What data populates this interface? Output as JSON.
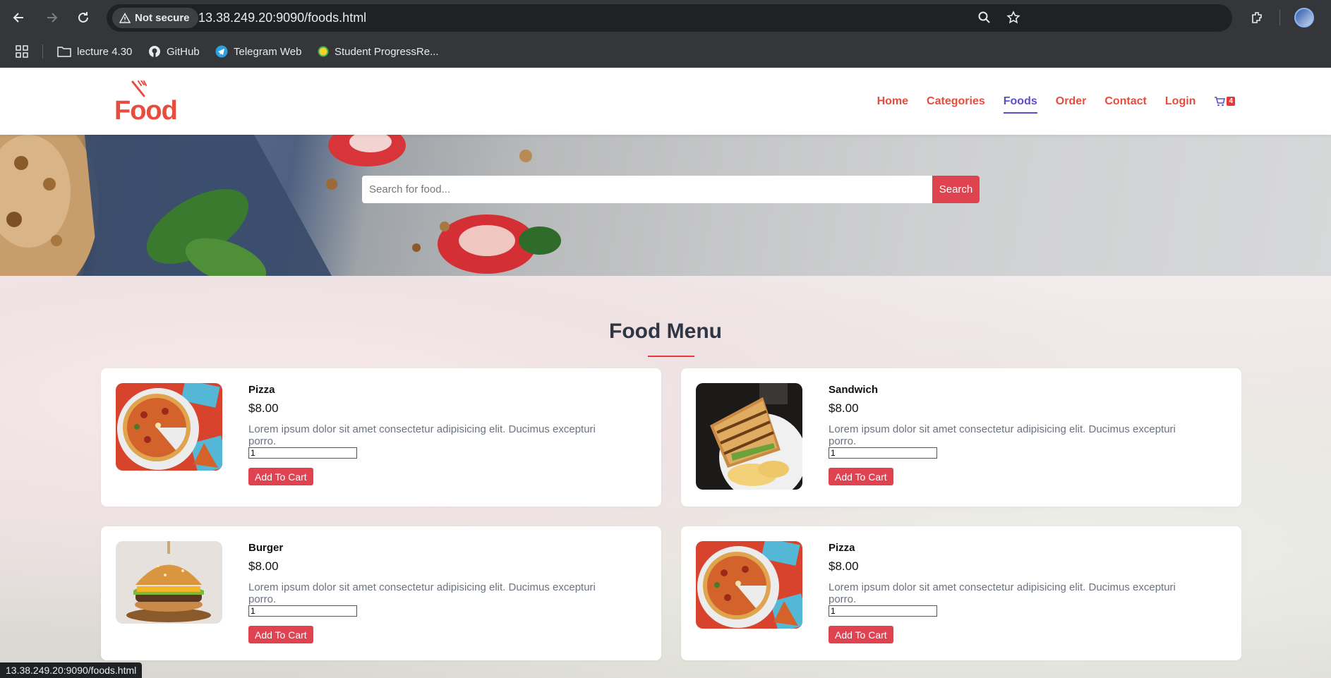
{
  "browser": {
    "security_label": "Not secure",
    "url": "13.38.249.20:9090/foods.html",
    "bookmarks": [
      {
        "label": "lecture 4.30",
        "icon": "folder-icon"
      },
      {
        "label": "GitHub",
        "icon": "github-icon"
      },
      {
        "label": "Telegram Web",
        "icon": "telegram-icon"
      },
      {
        "label": "Student ProgressRe...",
        "icon": "site-icon"
      }
    ],
    "status_url": "13.38.249.20:9090/foods.html"
  },
  "header": {
    "logo_text": "Food",
    "nav": [
      {
        "label": "Home",
        "active": false
      },
      {
        "label": "Categories",
        "active": false
      },
      {
        "label": "Foods",
        "active": true
      },
      {
        "label": "Order",
        "active": false
      },
      {
        "label": "Contact",
        "active": false
      },
      {
        "label": "Login",
        "active": false
      }
    ],
    "cart_count": "4"
  },
  "search": {
    "placeholder": "Search for food...",
    "button_label": "Search"
  },
  "menu": {
    "title": "Food Menu",
    "items": [
      {
        "name": "Pizza",
        "price": "$8.00",
        "description": "Lorem ipsum dolor sit amet consectetur adipisicing elit. Ducimus excepturi porro.",
        "quantity": "1",
        "button_label": "Add To Cart",
        "image": "pizza"
      },
      {
        "name": "Sandwich",
        "price": "$8.00",
        "description": "Lorem ipsum dolor sit amet consectetur adipisicing elit. Ducimus excepturi porro.",
        "quantity": "1",
        "button_label": "Add To Cart",
        "image": "sandwich"
      },
      {
        "name": "Burger",
        "price": "$8.00",
        "description": "Lorem ipsum dolor sit amet consectetur adipisicing elit. Ducimus excepturi porro.",
        "quantity": "1",
        "button_label": "Add To Cart",
        "image": "burger"
      },
      {
        "name": "Pizza",
        "price": "$8.00",
        "description": "Lorem ipsum dolor sit amet consectetur adipisicing elit. Ducimus excepturi porro.",
        "quantity": "1",
        "button_label": "Add To Cart",
        "image": "pizza"
      }
    ]
  },
  "colors": {
    "accent_red": "#e04350",
    "nav_active": "#5a4fcf",
    "title": "#2f3542"
  }
}
